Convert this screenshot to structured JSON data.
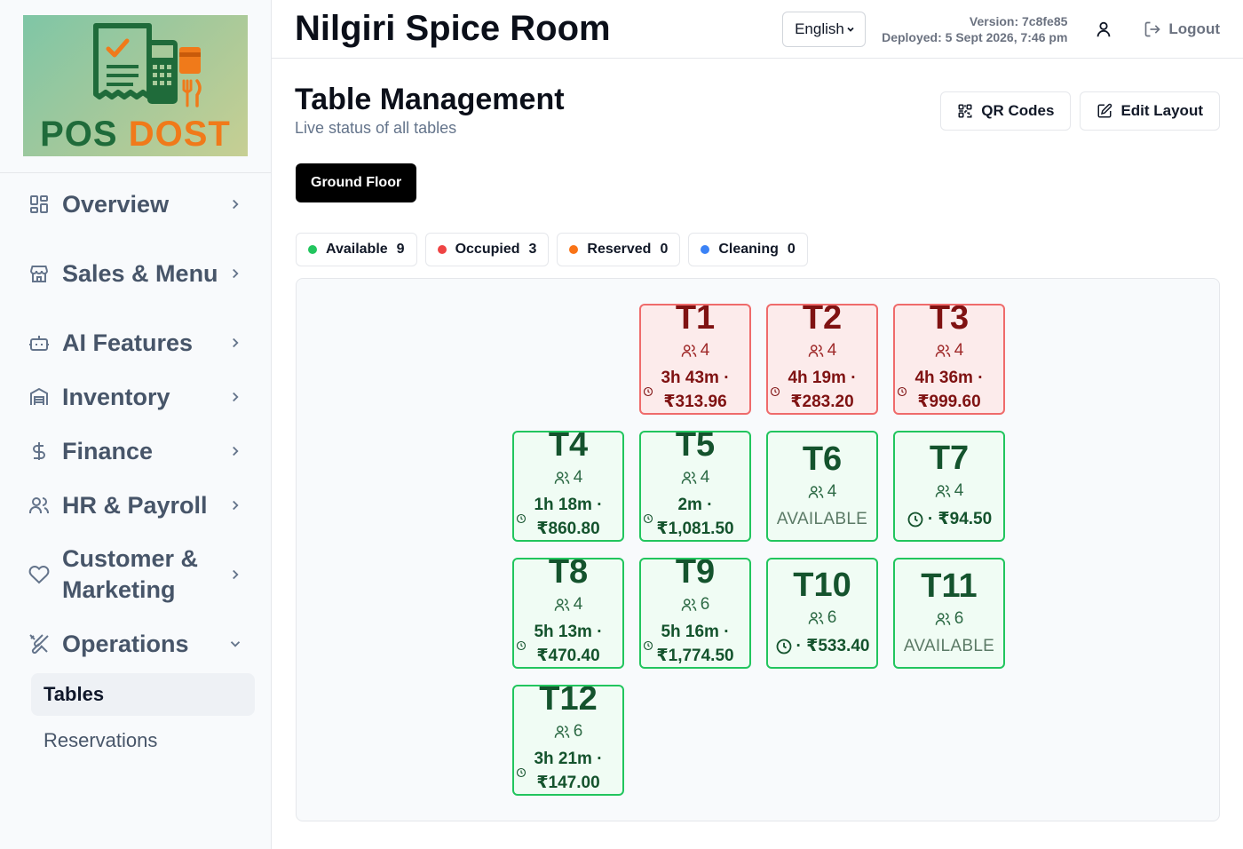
{
  "brand": {
    "logo_word1": "POS",
    "logo_word2": "DOST"
  },
  "sidebar": {
    "items": [
      {
        "label": "Overview",
        "icon": "layout-grid-icon"
      },
      {
        "label": "Sales & Menu",
        "icon": "store-icon"
      },
      {
        "label": "AI Features",
        "icon": "bot-icon"
      },
      {
        "label": "Inventory",
        "icon": "warehouse-icon"
      },
      {
        "label": "Finance",
        "icon": "dollar-icon"
      },
      {
        "label": "HR & Payroll",
        "icon": "users-icon"
      },
      {
        "label": "Customer & Marketing",
        "icon": "heart-icon"
      },
      {
        "label": "Operations",
        "icon": "utensils-crossed-icon"
      }
    ],
    "sub_items": [
      {
        "label": "Tables",
        "active": true
      },
      {
        "label": "Reservations",
        "active": false
      }
    ]
  },
  "header": {
    "title": "Nilgiri Spice Room",
    "language": "English",
    "version": "Version: 7c8fe85",
    "deployed": "Deployed: 5 Sept 2026, 7:46 pm",
    "logout": "Logout"
  },
  "page": {
    "title": "Table Management",
    "subtitle": "Live status of all tables",
    "qr_button": "QR Codes",
    "edit_button": "Edit Layout",
    "floor_tab": "Ground Floor"
  },
  "legend": [
    {
      "label": "Available",
      "count": "9",
      "color": "#22c55e"
    },
    {
      "label": "Occupied",
      "count": "3",
      "color": "#ef4444"
    },
    {
      "label": "Reserved",
      "count": "0",
      "color": "#f97316"
    },
    {
      "label": "Cleaning",
      "count": "0",
      "color": "#3b82f6"
    }
  ],
  "tables": [
    {
      "name": "T1",
      "seats": "4",
      "status": "occupied",
      "time": "3h 43m ·",
      "amount": "₹313.96"
    },
    {
      "name": "T2",
      "seats": "4",
      "status": "occupied",
      "time": "4h 19m ·",
      "amount": "₹283.20"
    },
    {
      "name": "T3",
      "seats": "4",
      "status": "occupied",
      "time": "4h 36m ·",
      "amount": "₹999.60"
    },
    {
      "name": "T4",
      "seats": "4",
      "status": "available",
      "time": "1h 18m ·",
      "amount": "₹860.80"
    },
    {
      "name": "T5",
      "seats": "4",
      "status": "available",
      "time": "2m ·",
      "amount": "₹1,081.50"
    },
    {
      "name": "T6",
      "seats": "4",
      "status": "available",
      "label": "AVAILABLE"
    },
    {
      "name": "T7",
      "seats": "4",
      "status": "available",
      "amount_line": "· ₹94.50"
    },
    {
      "name": "T8",
      "seats": "4",
      "status": "available",
      "time": "5h 13m ·",
      "amount": "₹470.40"
    },
    {
      "name": "T9",
      "seats": "6",
      "status": "available",
      "time": "5h 16m ·",
      "amount": "₹1,774.50"
    },
    {
      "name": "T10",
      "seats": "6",
      "status": "available",
      "amount_line": "· ₹533.40"
    },
    {
      "name": "T11",
      "seats": "6",
      "status": "available",
      "label": "AVAILABLE"
    },
    {
      "name": "T12",
      "seats": "6",
      "status": "available",
      "time": "3h 21m ·",
      "amount": "₹147.00"
    }
  ]
}
